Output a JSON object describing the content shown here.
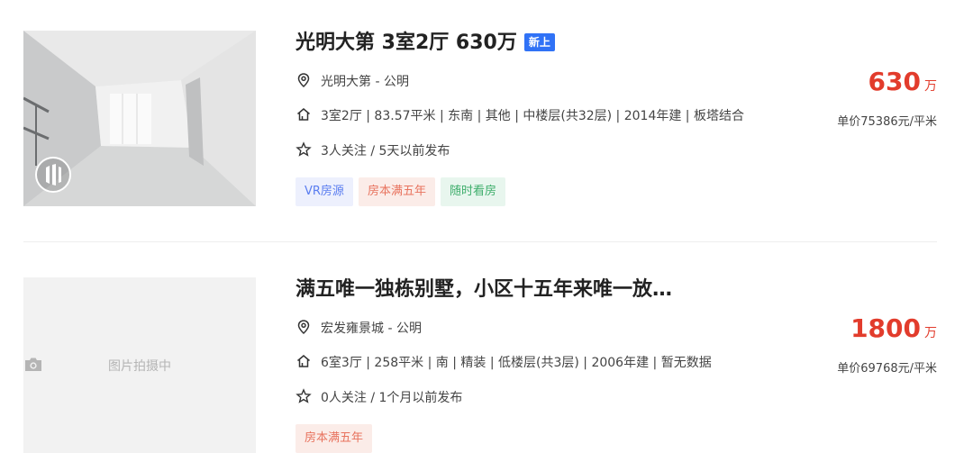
{
  "listings": [
    {
      "title": "光明大第 3室2厅 630万",
      "badge": "新上",
      "location": "光明大第 - 公明",
      "details": "3室2厅 | 83.57平米 | 东南 | 其他 | 中楼层(共32层) | 2014年建 | 板塔结合",
      "follow": "3人关注 / 5天以前发布",
      "tags": [
        "VR房源",
        "房本满五年",
        "随时看房"
      ],
      "price": "630",
      "price_unit": "万",
      "unit_price": "单价75386元/平米"
    },
    {
      "title": "满五唯一独栋别墅，小区十五年来唯一放…",
      "location": "宏发雍景城 - 公明",
      "details": "6室3厅 | 258平米 | 南 | 精装 | 低楼层(共3层) | 2006年建 | 暂无数据",
      "follow": "0人关注 / 1个月以前发布",
      "tags": [
        "房本满五年"
      ],
      "price": "1800",
      "price_unit": "万",
      "unit_price": "单价69768元/平米",
      "thumb_placeholder": "图片拍摄中"
    }
  ],
  "colors": {
    "price": "#e23c2c",
    "badge": "#3072f6",
    "tag_vr": "#5a7df0",
    "tag_five": "#e8735e",
    "tag_anytime": "#3fae6c"
  },
  "icons": {
    "location": "location-pin-icon",
    "details": "house-icon",
    "follow": "star-icon",
    "vr": "vr-icon",
    "placeholder": "camera-icon"
  }
}
